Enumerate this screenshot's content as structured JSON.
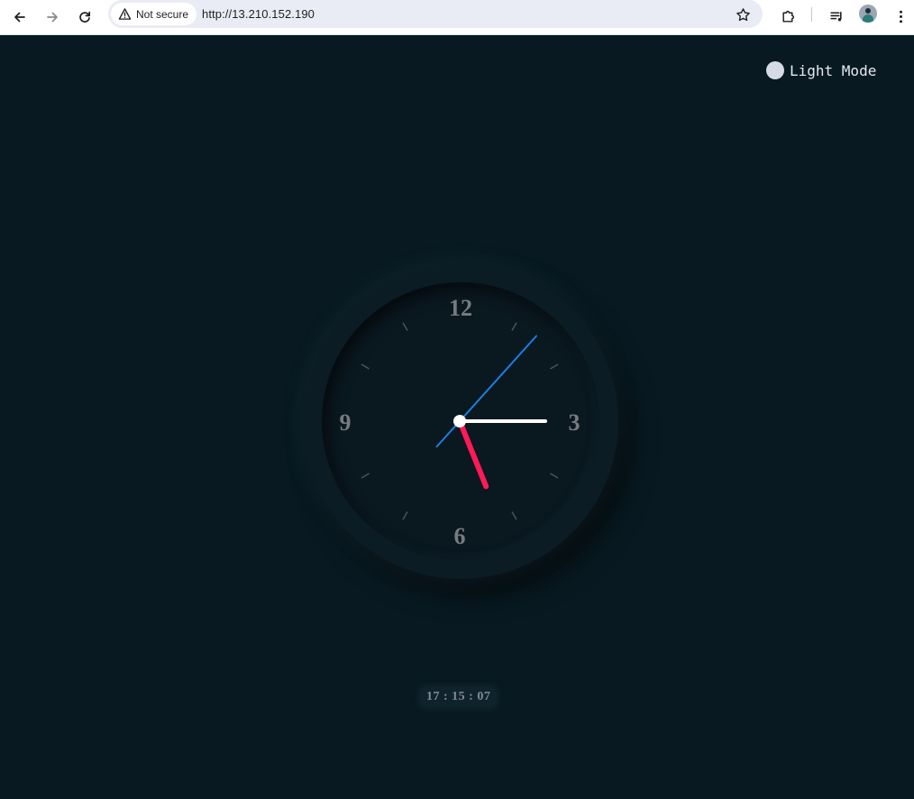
{
  "browser": {
    "security_label": "Not secure",
    "url": "http://13.210.152.190"
  },
  "page": {
    "mode_toggle_label": "Light Mode",
    "clock": {
      "numerals": [
        "12",
        "3",
        "6",
        "9"
      ],
      "time": {
        "hours": 17,
        "minutes": 15,
        "seconds": 7
      },
      "colors": {
        "background": "#081921",
        "hour_hand": "#ff1a57",
        "minute_hand": "#ffffff",
        "second_hand": "#1a7fe0",
        "numerals": "#777b80"
      }
    },
    "digital_time": "17 : 15 : 07"
  }
}
